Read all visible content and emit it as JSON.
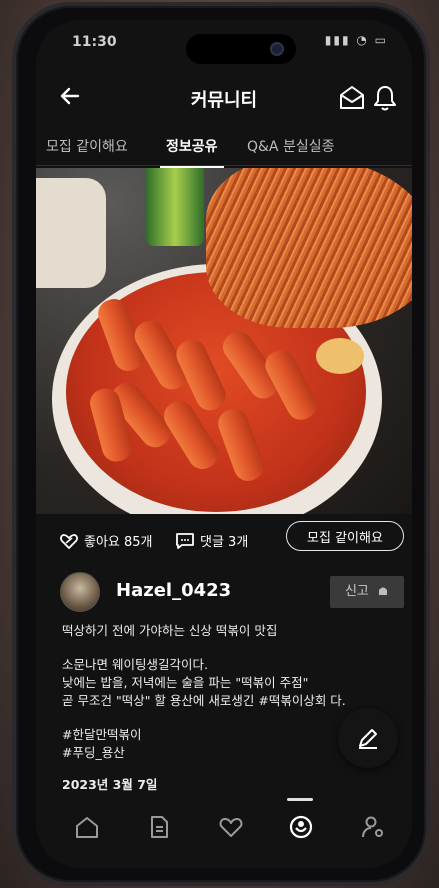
{
  "status_bar": {
    "time": "11:30",
    "indicators": "▮▮▮ ◔ ▭"
  },
  "header": {
    "title": "커뮤니티",
    "back_icon": "arrow-left-icon",
    "mail_icon": "mail-open-icon",
    "bell_icon": "bell-icon"
  },
  "tabs": [
    {
      "label": "모집 같이해요",
      "active": false
    },
    {
      "label": "정보공유",
      "active": true
    },
    {
      "label": "Q&A 분실실종",
      "active": false
    }
  ],
  "post": {
    "likes_label": "좋아요 85개",
    "comments_label": "댓글 3개",
    "recruit_button": "모집 같이해요",
    "author": "Hazel_0423",
    "report_button": "신고",
    "headline": "떡상하기 전에 가야하는 신상 떡볶이 맛집",
    "body_lines": [
      "소문나면 웨이팅생길각이다.",
      "낮에는 밥을, 저녁에는 술을 파는 \"떡볶이 주점\"",
      "곧 무조건 \"떡상\" 할 용산에 새로생긴 #떡볶이상회 다."
    ],
    "tags": [
      "#한달만떡볶이",
      "#푸딩_용산"
    ],
    "date": "2023년 3월 7일"
  },
  "bottom_nav": [
    {
      "name": "home",
      "icon": "home-icon"
    },
    {
      "name": "board",
      "icon": "document-icon"
    },
    {
      "name": "likes",
      "icon": "heart-icon"
    },
    {
      "name": "community",
      "icon": "chat-bubble-icon",
      "active": true
    },
    {
      "name": "mypage",
      "icon": "user-settings-icon"
    }
  ],
  "colors": {
    "background": "#121212",
    "text": "#ffffff",
    "muted": "#bdbdbd",
    "report_bg": "#3a3a3a"
  }
}
